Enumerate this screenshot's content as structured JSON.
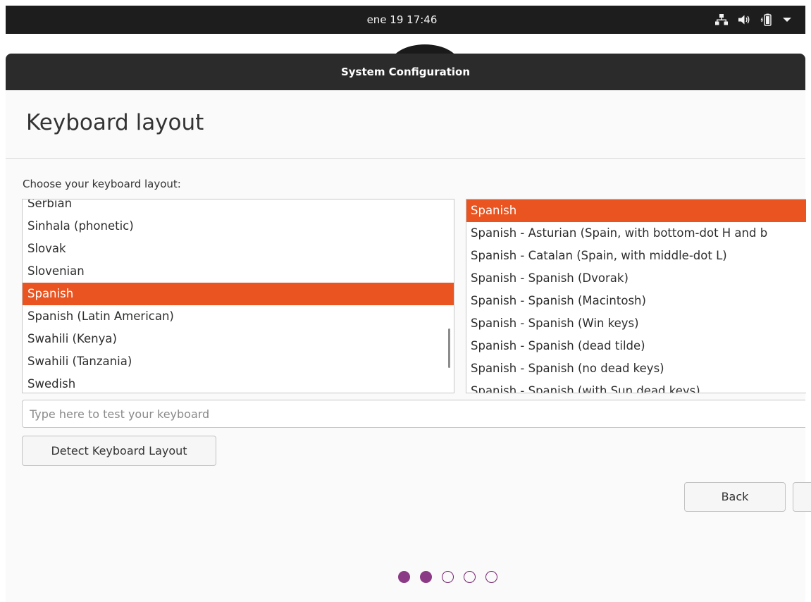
{
  "topbar": {
    "clock": "ene 19  17:46",
    "icons": [
      "network-icon",
      "volume-icon",
      "battery-icon",
      "system-menu-arrow-icon"
    ]
  },
  "window": {
    "title": "System Configuration"
  },
  "page": {
    "title": "Keyboard layout",
    "choose_label": "Choose your keyboard layout:"
  },
  "layout_list": {
    "items": [
      "Serbian",
      "Sinhala (phonetic)",
      "Slovak",
      "Slovenian",
      "Spanish",
      "Spanish (Latin American)",
      "Swahili (Kenya)",
      "Swahili (Tanzania)",
      "Swedish"
    ],
    "selected": "Spanish"
  },
  "variant_list": {
    "items": [
      "Spanish",
      "Spanish - Asturian (Spain, with bottom-dot H and b",
      "Spanish - Catalan (Spain, with middle-dot L)",
      "Spanish - Spanish (Dvorak)",
      "Spanish - Spanish (Macintosh)",
      "Spanish - Spanish (Win keys)",
      "Spanish - Spanish (dead tilde)",
      "Spanish - Spanish (no dead keys)",
      "Spanish - Spanish (with Sun dead keys)"
    ],
    "selected": "Spanish"
  },
  "test_input": {
    "placeholder": "Type here to test your keyboard",
    "value": ""
  },
  "buttons": {
    "detect": "Detect Keyboard Layout",
    "back": "Back",
    "next": ""
  },
  "progress": {
    "total_steps": 5,
    "completed_steps": 2
  },
  "colors": {
    "accent": "#E95420",
    "topbar_bg": "#1D1D1D",
    "titlebar_bg": "#2B2B2B",
    "progress_dot": "#8B3A86"
  }
}
